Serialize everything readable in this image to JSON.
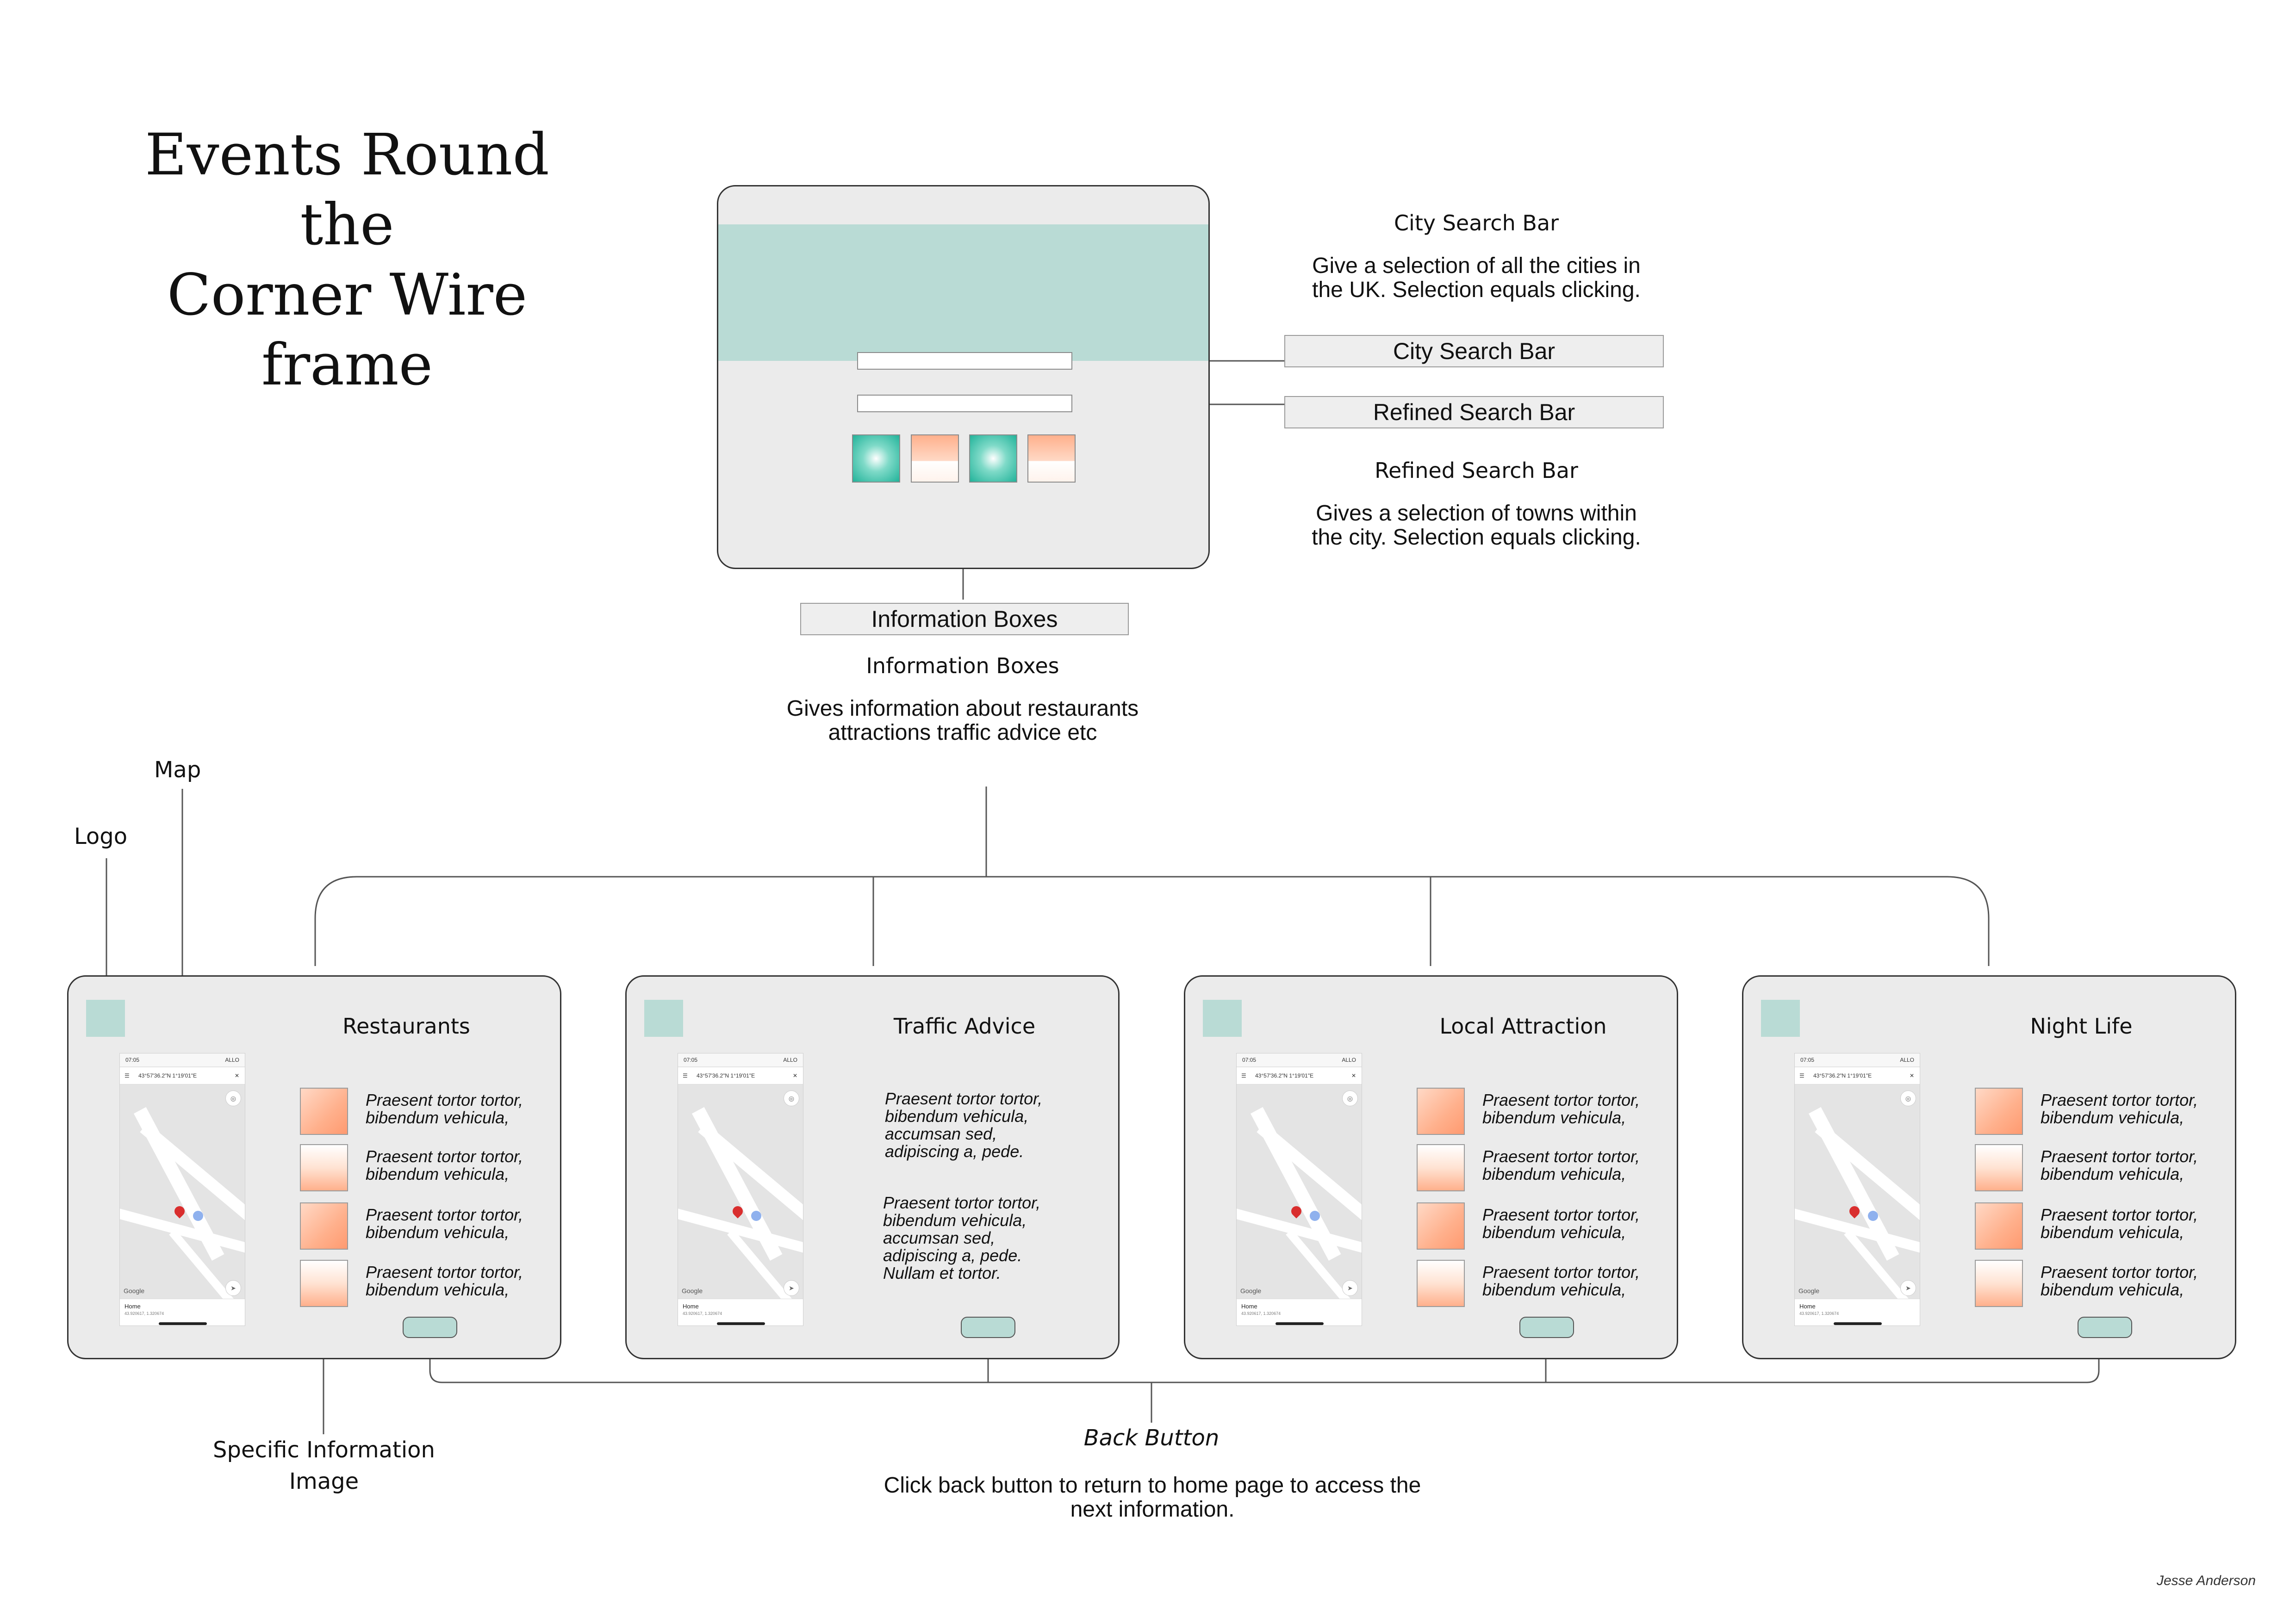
{
  "title": {
    "line1": "Events Round the",
    "line2": "Corner Wire frame"
  },
  "home": {
    "city_search_box_label": "City Search Bar",
    "refined_search_box_label": "Refined Search Bar",
    "information_boxes_box_label": "Information Boxes",
    "city_note_title": "City Search Bar",
    "city_note_line1": "Give a selection of all the cities in",
    "city_note_line2": "the UK. Selection equals clicking.",
    "refined_note_title": "Refined Search Bar",
    "refined_note_line1": "Gives a selection of towns within",
    "refined_note_line2": "the city. Selection equals clicking.",
    "info_note_title": "Information Boxes",
    "info_note_line1": "Gives information about restaurants",
    "info_note_line2": "attractions traffic advice etc"
  },
  "annotations": {
    "map": "Map",
    "logo": "Logo",
    "specific_info_line1": "Specific Information",
    "specific_info_line2": "Image",
    "back_button": "Back Button",
    "back_note_line1": "Click back button to return to home page to access the",
    "back_note_line2": "next information."
  },
  "map_mock": {
    "time": "07:05",
    "signal": "ALLO",
    "query": "43°57'36.2\"N 1°19'01\"E",
    "google": "Google",
    "home_label": "Home",
    "coords": "43.920617, 1.320674"
  },
  "pages": [
    {
      "title": "Restaurants",
      "items": [
        "Praesent tortor tortor,|bibendum vehicula,",
        "Praesent tortor tortor,|bibendum vehicula,",
        "Praesent tortor tortor,|bibendum vehicula,",
        "Praesent tortor tortor,|bibendum vehicula,"
      ]
    },
    {
      "title": "Traffic Advice",
      "para1": [
        "Praesent tortor tortor,",
        "bibendum vehicula,",
        "accumsan sed,",
        "adipiscing a, pede."
      ],
      "para2": [
        "Praesent tortor tortor,",
        "bibendum vehicula,",
        "accumsan sed,",
        "adipiscing a, pede.",
        "Nullam et tortor."
      ]
    },
    {
      "title": "Local Attraction",
      "items": [
        "Praesent tortor tortor,|bibendum vehicula,",
        "Praesent tortor tortor,|bibendum vehicula,",
        "Praesent tortor tortor,|bibendum vehicula,",
        "Praesent tortor tortor,|bibendum vehicula,"
      ]
    },
    {
      "title": "Night Life",
      "items": [
        "Praesent tortor tortor,|bibendum vehicula,",
        "Praesent tortor tortor,|bibendum vehicula,",
        "Praesent tortor tortor,|bibendum vehicula,",
        "Praesent tortor tortor,|bibendum vehicula,"
      ]
    }
  ],
  "signature": "Jesse Anderson",
  "colors": {
    "teal": "#b9dbd5",
    "frame_bg": "#ebebeb",
    "orange": "#ffb08c",
    "line": "#555555"
  }
}
